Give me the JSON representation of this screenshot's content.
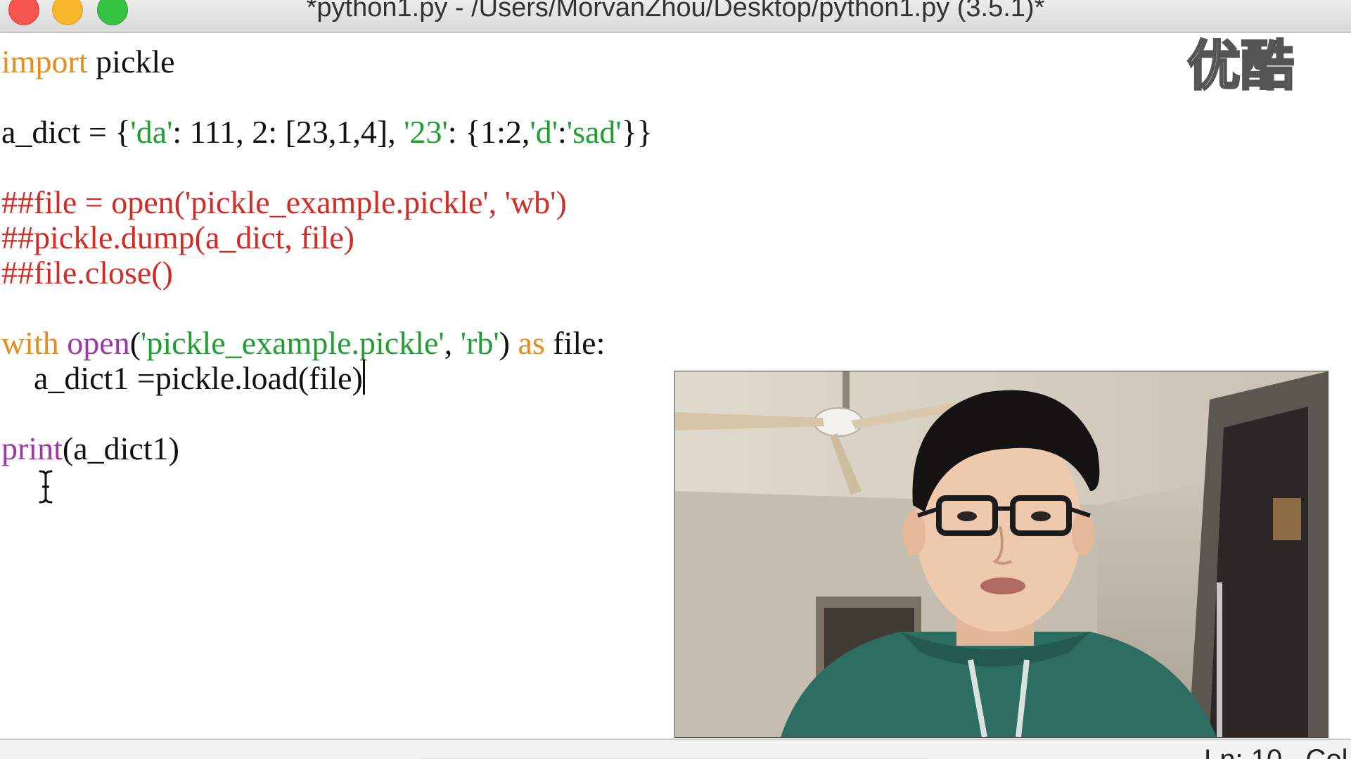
{
  "window": {
    "title": "*python1.py - /Users/MorvanZhou/Desktop/python1.py (3.5.1)*"
  },
  "watermark": {
    "text": "优酷"
  },
  "code": {
    "line1": {
      "kw": "import",
      "rest": " pickle"
    },
    "line2": {
      "p1": "a_dict = {",
      "s1": "'da'",
      "p2": ": 111, 2: [23,1,4], ",
      "s2": "'23'",
      "p3": ": {1:2,",
      "s3": "'d'",
      "p4": ":",
      "s4": "'sad'",
      "p5": "}}"
    },
    "line3": {
      "text": "##file = open('pickle_example.pickle', 'wb')"
    },
    "line4": {
      "text": "##pickle.dump(a_dict, file)"
    },
    "line5": {
      "text": "##file.close()"
    },
    "line6": {
      "kw1": "with",
      "sp1": " ",
      "bi": "open",
      "p1": "(",
      "s1": "'pickle_example.pickle'",
      "p2": ", ",
      "s2": "'rb'",
      "p3": ") ",
      "kw2": "as",
      "p4": " file:"
    },
    "line7": {
      "text": "    a_dict1 =pickle.load(file)"
    },
    "line8": {
      "bi": "print",
      "rest": "(a_dict1)"
    }
  },
  "status": {
    "text": "Ln: 10   Col"
  },
  "colors": {
    "keyword": "#e88c1d",
    "string": "#1f9e32",
    "comment": "#d42a24",
    "builtin": "#9b37a8"
  }
}
